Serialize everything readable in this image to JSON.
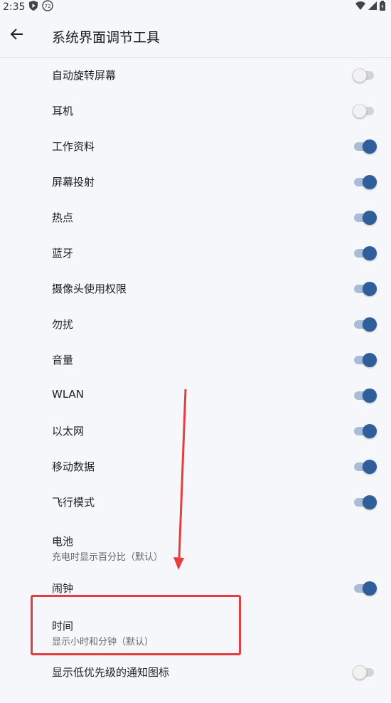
{
  "status": {
    "time": "2:35",
    "badge": "72"
  },
  "appbar": {
    "title": "系统界面调节工具"
  },
  "items": [
    {
      "label": "自动旋转屏幕",
      "state": "off"
    },
    {
      "label": "耳机",
      "state": "off"
    },
    {
      "label": "工作资料",
      "state": "on"
    },
    {
      "label": "屏幕投射",
      "state": "on"
    },
    {
      "label": "热点",
      "state": "on"
    },
    {
      "label": "蓝牙",
      "state": "on"
    },
    {
      "label": "摄像头使用权限",
      "state": "on"
    },
    {
      "label": "勿扰",
      "state": "on"
    },
    {
      "label": "音量",
      "state": "on"
    },
    {
      "label": "WLAN",
      "state": "on"
    },
    {
      "label": "以太网",
      "state": "on"
    },
    {
      "label": "移动数据",
      "state": "on"
    },
    {
      "label": "飞行模式",
      "state": "on"
    },
    {
      "label": "电池",
      "sub": "充电时显示百分比（默认）"
    },
    {
      "label": "闹钟",
      "state": "on"
    },
    {
      "label": "时间",
      "sub": "显示小时和分钟（默认）"
    },
    {
      "label": "显示低优先级的通知图标",
      "state": "off"
    }
  ],
  "colors": {
    "accent": "#2e5f9a",
    "annotation": "#e53e3e"
  }
}
